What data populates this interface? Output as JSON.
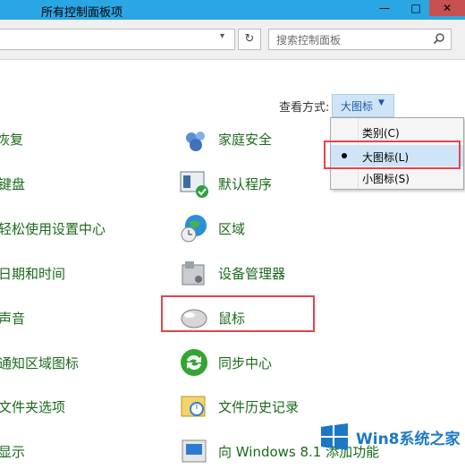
{
  "window": {
    "title": "所有控制面板项",
    "minimize_glyph": "—",
    "maximize_glyph": "□",
    "close_glyph": "✕"
  },
  "address": {
    "search_placeholder": "搜索控制面板",
    "refresh_glyph": "↻"
  },
  "view": {
    "label": "查看方式:",
    "current": "大图标",
    "options": [
      {
        "label": "类别(C)",
        "selected": false
      },
      {
        "label": "大图标(L)",
        "selected": true
      },
      {
        "label": "小图标(S)",
        "selected": false
      }
    ]
  },
  "left_items": [
    {
      "label": "恢复",
      "icon": "recovery-icon"
    },
    {
      "label": "键盘",
      "icon": "keyboard-icon"
    },
    {
      "label": "轻松使用设置中心",
      "icon": "ease-of-access-icon"
    },
    {
      "label": "日期和时间",
      "icon": "clock-icon"
    },
    {
      "label": "声音",
      "icon": "speaker-icon"
    },
    {
      "label": "通知区域图标",
      "icon": "notification-icon"
    },
    {
      "label": "文件夹选项",
      "icon": "folder-options-icon"
    },
    {
      "label": "显示",
      "icon": "display-icon"
    }
  ],
  "right_items": [
    {
      "label": "家庭安全",
      "icon": "family-safety-icon"
    },
    {
      "label": "默认程序",
      "icon": "default-programs-icon"
    },
    {
      "label": "区域",
      "icon": "region-globe-icon"
    },
    {
      "label": "设备管理器",
      "icon": "device-manager-icon"
    },
    {
      "label": "鼠标",
      "icon": "mouse-icon"
    },
    {
      "label": "同步中心",
      "icon": "sync-center-icon"
    },
    {
      "label": "文件历史记录",
      "icon": "file-history-icon"
    },
    {
      "label": "向 Windows 8.1 添加功能",
      "icon": "add-features-icon"
    }
  ],
  "watermark": {
    "text": "Win8系统之家",
    "icon": "windows-logo-icon"
  },
  "colors": {
    "link_green": "#1b6a1b",
    "highlight_red": "#e8434b",
    "titlebar_blue": "#2aa6e4"
  }
}
